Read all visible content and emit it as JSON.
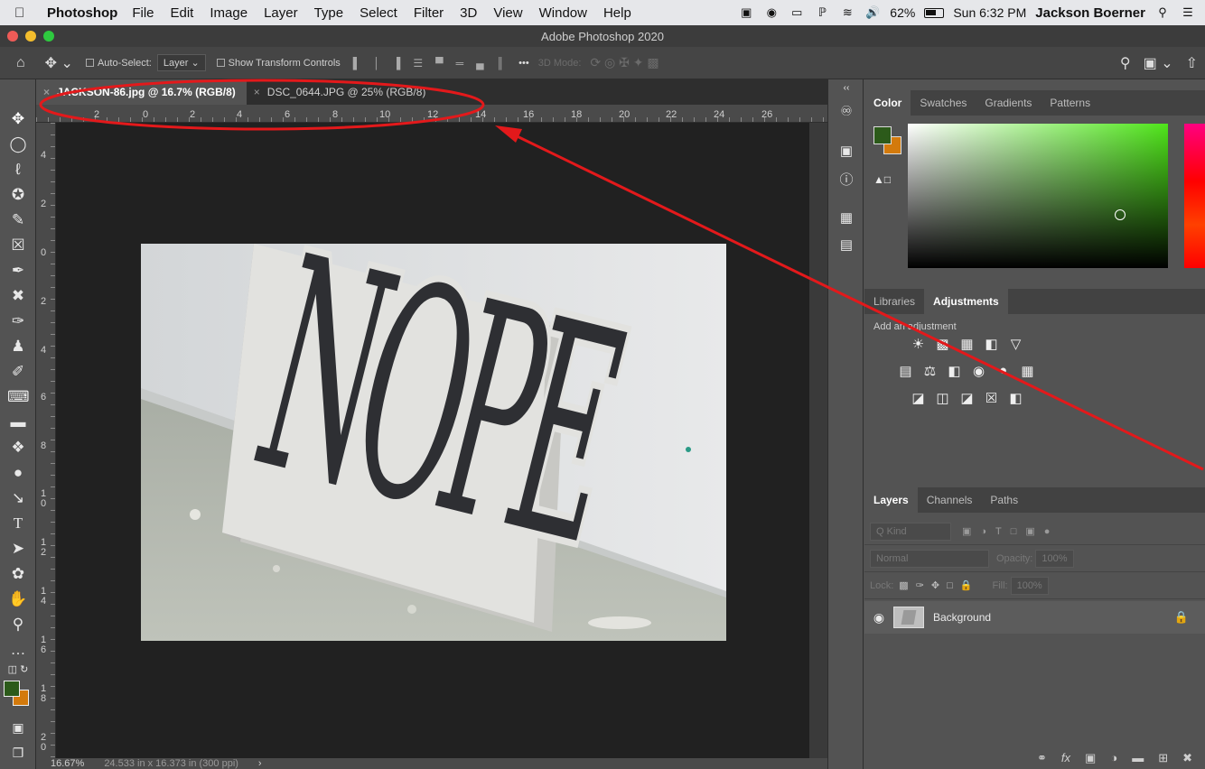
{
  "menubar": {
    "app_name": "Photoshop",
    "items": [
      "File",
      "Edit",
      "Image",
      "Layer",
      "Type",
      "Select",
      "Filter",
      "3D",
      "View",
      "Window",
      "Help"
    ],
    "battery": "62%",
    "clock": "Sun 6:32 PM",
    "user": "Jackson Boerner"
  },
  "window": {
    "title": "Adobe Photoshop 2020"
  },
  "options_bar": {
    "auto_select_label": "Auto-Select:",
    "auto_select_value": "Layer",
    "show_transform_label": "Show Transform Controls",
    "more_label": "•••",
    "mode_3d_label": "3D Mode:"
  },
  "tabs": [
    {
      "label": "JACKSON-86.jpg @ 16.7% (RGB/8)",
      "active": true
    },
    {
      "label": "DSC_0644.JPG @ 25% (RGB/8)",
      "active": false
    }
  ],
  "ruler": {
    "top_ticks": [
      "2",
      "0",
      "2",
      "4",
      "6",
      "8",
      "10",
      "12",
      "14",
      "16",
      "18",
      "20",
      "22",
      "24",
      "26"
    ],
    "left_ticks": [
      "4",
      "2",
      "0",
      "2",
      "4",
      "6",
      "8",
      "10",
      "12",
      "14",
      "16",
      "18",
      "20"
    ]
  },
  "status_bar": {
    "zoom": "16.67%",
    "doc_info": "24.533 in x 16.373 in (300 ppi)",
    "arrow": "›"
  },
  "photo": {
    "sign_text": "NOPE"
  },
  "color_panel": {
    "tabs": [
      "Color",
      "Swatches",
      "Gradients",
      "Patterns"
    ],
    "fg_color": "#2c5a1a",
    "bg_color": "#d37a0c"
  },
  "adjustments_panel": {
    "tabs": [
      "Libraries",
      "Adjustments"
    ],
    "hint": "Add an adjustment"
  },
  "layers_panel": {
    "tabs": [
      "Layers",
      "Channels",
      "Paths"
    ],
    "filter_placeholder": "Q Kind",
    "blend_mode": "Normal",
    "opacity_label": "Opacity:",
    "opacity_value": "100%",
    "lock_label": "Lock:",
    "fill_label": "Fill:",
    "fill_value": "100%",
    "layers": [
      {
        "name": "Background",
        "visible": true,
        "locked": true
      }
    ]
  },
  "annotation": {
    "color": "#e3191b"
  }
}
